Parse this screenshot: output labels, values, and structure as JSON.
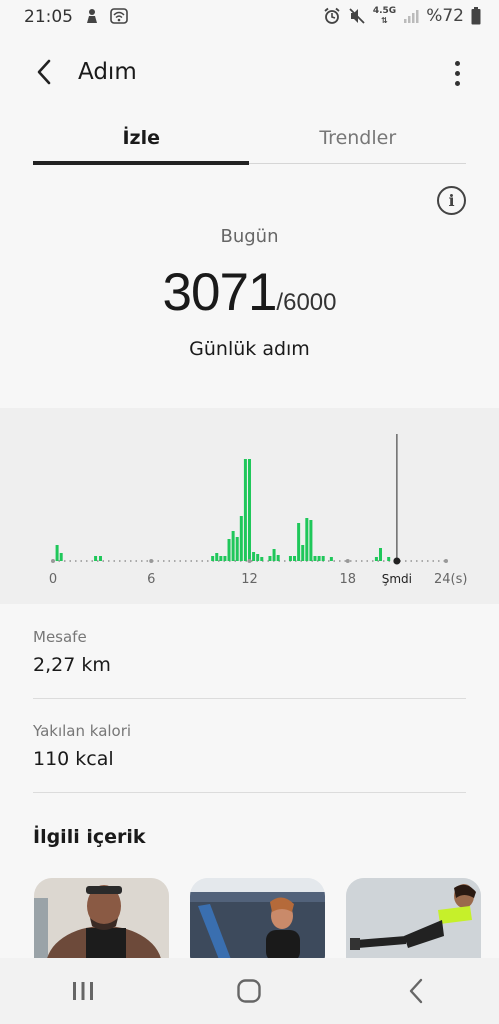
{
  "status_bar": {
    "time": "21:05",
    "network_label": "4.5G",
    "battery": "%72"
  },
  "app_bar": {
    "title": "Adım",
    "back_icon": "chevron-left-icon",
    "more_icon": "more-vertical-icon"
  },
  "tabs": [
    {
      "label": "İzle",
      "active": true
    },
    {
      "label": "Trendler",
      "active": false
    }
  ],
  "summary": {
    "day_label": "Bugün",
    "steps": "3071",
    "goal": "/6000",
    "caption": "Günlük adım"
  },
  "chart_data": {
    "type": "bar",
    "x_min": 0,
    "x_max": 24,
    "x_unit": "(s)",
    "tick_values": [
      0,
      6,
      12,
      18,
      24
    ],
    "tick_labels": [
      "0",
      "6",
      "12",
      "18",
      "24(s)"
    ],
    "now_label": "Şmdi",
    "now_hour": 21,
    "bar_color": "#1fc75a",
    "values": [
      [
        0.25,
        16
      ],
      [
        0.5,
        8
      ],
      [
        2.6,
        5
      ],
      [
        2.9,
        5
      ],
      [
        9.75,
        5
      ],
      [
        10.0,
        8
      ],
      [
        10.25,
        5
      ],
      [
        10.5,
        5
      ],
      [
        10.75,
        22
      ],
      [
        11.0,
        30
      ],
      [
        11.25,
        24
      ],
      [
        11.5,
        45
      ],
      [
        11.75,
        102
      ],
      [
        12.0,
        102
      ],
      [
        12.25,
        9
      ],
      [
        12.5,
        7
      ],
      [
        12.75,
        4
      ],
      [
        13.25,
        5
      ],
      [
        13.5,
        12
      ],
      [
        13.75,
        6
      ],
      [
        14.5,
        5
      ],
      [
        14.75,
        5
      ],
      [
        15.0,
        38
      ],
      [
        15.25,
        16
      ],
      [
        15.5,
        43
      ],
      [
        15.75,
        41
      ],
      [
        16.0,
        5
      ],
      [
        16.25,
        5
      ],
      [
        16.5,
        5
      ],
      [
        17.0,
        4
      ],
      [
        19.75,
        4
      ],
      [
        20.0,
        13
      ],
      [
        20.5,
        4
      ]
    ]
  },
  "stats": {
    "distance": {
      "label": "Mesafe",
      "value": "2,27 km"
    },
    "calories": {
      "label": "Yakılan kalori",
      "value": "110 kcal"
    },
    "related_title": "İlgili içerik"
  },
  "nav_bar": {
    "recents_icon": "recents-icon",
    "home_icon": "home-icon",
    "back_icon": "back-icon"
  }
}
